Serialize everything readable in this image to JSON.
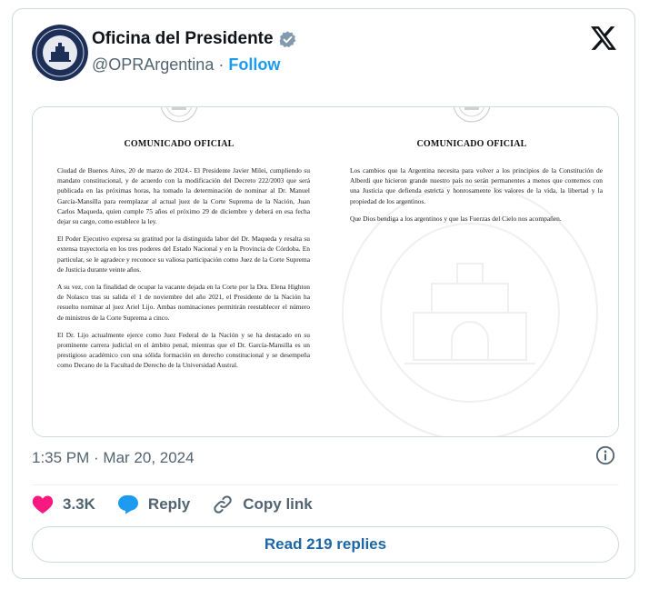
{
  "author": {
    "name": "Oficina del Presidente",
    "handle": "@OPRArgentina",
    "separator": "·",
    "follow_label": "Follow"
  },
  "media": {
    "left_page": {
      "title": "COMUNICADO OFICIAL",
      "paragraphs": [
        "Ciudad de Buenos Aires, 20 de marzo de 2024.- El Presidente Javier Milei, cumpliendo su mandato constitucional, y de acuerdo con la modificación del Decreto 222/2003 que será publicada en las próximas horas, ha tomado la determinación de nominar al Dr. Manuel García-Mansilla para reemplazar al actual juez de la Corte Suprema de la Nación, Juan Carlos Maqueda, quien cumple 75 años el próximo 29 de diciembre y deberá en esa fecha dejar su cargo, como establece la ley.",
        "El Poder Ejecutivo expresa su gratitud por la distinguida labor del Dr. Maqueda y resalta su extensa trayectoria en los tres poderes del Estado Nacional y en la Provincia de Córdoba. En particular, se le agradece y reconoce su valiosa participación como Juez de la Corte Suprema de Justicia durante veinte años.",
        "A su vez, con la finalidad de ocupar la vacante dejada en la Corte por la Dra. Elena Highton de Nolasco tras su salida el 1 de noviembre del año 2021, el Presidente de la Nación ha resuelto nominar al juez Ariel Lijo. Ambas nominaciones permitirán reestablecer el número de ministros de la Corte Suprema a cinco.",
        "El Dr. Lijo actualmente ejerce como Juez Federal de la Nación y se ha destacado en su prominente carrera judicial en el ámbito penal, mientras que el Dr. García-Mansilla es un prestigioso académico con una sólida formación en derecho constitucional y se desempeña como Decano de la Facultad de Derecho de la Universidad Austral."
      ]
    },
    "right_page": {
      "title": "COMUNICADO OFICIAL",
      "paragraphs": [
        "Los cambios que la Argentina necesita para volver a los principios de la Constitución de Alberdi que hicieron grande nuestro país no serán permanentes a menos que contemos con una Justicia que defienda estricta y honrosamente los valores de la vida, la libertad y la propiedad de los argentinos.",
        "Que Dios bendiga a los argentinos y que las Fuerzas del Cielo nos acompañen."
      ]
    }
  },
  "timestamp": "1:35 PM · Mar 20, 2024",
  "actions": {
    "like_count": "3.3K",
    "reply_label": "Reply",
    "copy_link_label": "Copy link"
  },
  "read_replies_label": "Read 219 replies",
  "colors": {
    "accent": "#1d9bf0",
    "like": "#f91880",
    "text": "#0f1419",
    "muted": "#536471",
    "border": "#cfd9de"
  },
  "icons": [
    "verified-badge-icon",
    "x-logo-icon",
    "info-icon",
    "heart-icon",
    "reply-icon",
    "link-icon"
  ]
}
